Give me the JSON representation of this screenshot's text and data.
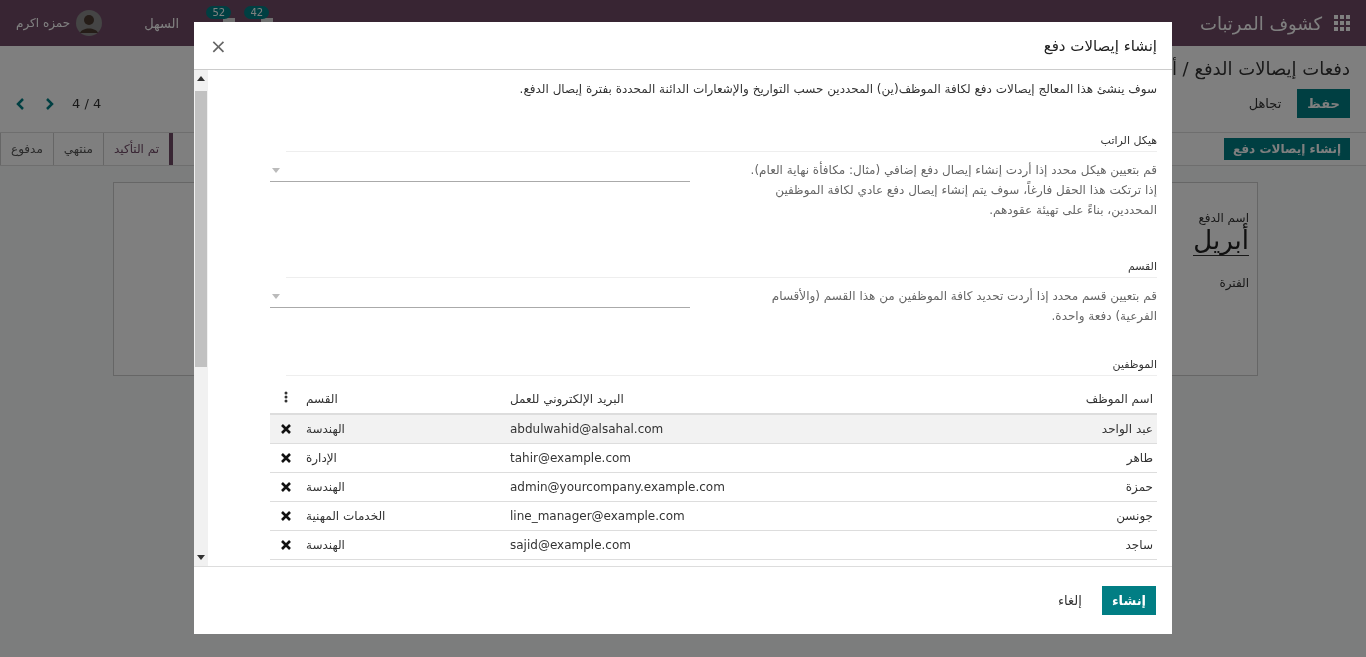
{
  "navbar": {
    "app_title": "كشوف المرتبات",
    "company": "السهل",
    "user": "حمزه اكرم",
    "badges": [
      {
        "count": "42"
      },
      {
        "count": "52"
      }
    ]
  },
  "breadcrumb": "دفعات إيصالات الدفع / أ",
  "form_buttons": [
    {
      "label": "حفظ",
      "kind": "primary"
    },
    {
      "label": "تجاهل",
      "kind": "secondary"
    }
  ],
  "pager": "4 / 4",
  "action_button": "إنشاء إيصالات دفع",
  "status_steps": [
    {
      "label": "تم التأكيد",
      "selected": true
    },
    {
      "label": "منتهي",
      "selected": false
    },
    {
      "label": "مدفوع",
      "selected": false
    }
  ],
  "sheet": {
    "name_label": "اسم الدفع",
    "name_value": "أبريل",
    "period_label": "الفترة"
  },
  "dialog": {
    "title": "إنشاء إيصالات دفع",
    "close": "×",
    "intro": "سوف ينشئ هذا المعالج إيصالات دفع لكافة الموظف(ين) المحددين حسب التواريخ والإشعارات الدائنة المحددة بفترة إيصال الدفع.",
    "fields": [
      {
        "label": "هيكل الراتب",
        "help": [
          "قم بتعيين هيكل محدد إذا أردت إنشاء إيصال دفع إضافي (مثال: مكافأة نهاية العام).",
          "إذا ترتكت هذا الحقل فارغاً، سوف يتم إنشاء إيصال دفع عادي لكافة الموظفين المحددين، بناءً على تهيئة عقودهم."
        ]
      },
      {
        "label": "القسم",
        "help": [
          "قم بتعيين قسم محدد إذا أردت تحديد كافة الموظفين من هذا القسم (والأقسام الفرعية) دفعة واحدة."
        ]
      }
    ],
    "employees_label": "الموظفين",
    "columns": [
      "اسم الموظف",
      "البريد الإلكتروني للعمل",
      "القسم"
    ],
    "rows": [
      {
        "name": "عبد الواحد",
        "email": "abdulwahid@alsahal.com",
        "department": "الهندسة"
      },
      {
        "name": "طاهر",
        "email": "tahir@example.com",
        "department": "الإدارة"
      },
      {
        "name": "حمزة",
        "email": "admin@yourcompany.example.com",
        "department": "الهندسة"
      },
      {
        "name": "جونسن",
        "email": "line_manager@example.com",
        "department": "الخدمات المهنية"
      },
      {
        "name": "ساجد",
        "email": "sajid@example.com",
        "department": "الهندسة"
      }
    ],
    "buttons": [
      {
        "label": "إنشاء",
        "kind": "primary"
      },
      {
        "label": "إلغاء",
        "kind": "secondary"
      }
    ]
  }
}
